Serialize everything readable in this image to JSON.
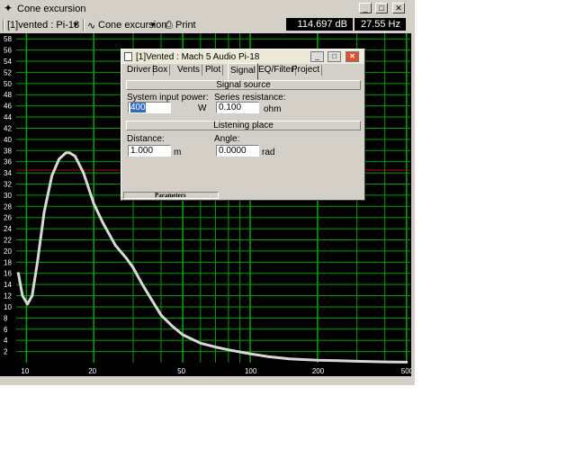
{
  "window": {
    "title": "Cone excursion",
    "title_icon": "crosshair-icon",
    "minimize": "_",
    "maximize": "□",
    "close": "✕"
  },
  "toolbar": {
    "driver_select": "[1]vented : Pi-18",
    "dropdown_arrow": "▼",
    "view_select": "Cone excursion",
    "print_label": "Print",
    "readout_db": "114.697 dB",
    "readout_hz": "27.55 Hz"
  },
  "dialog": {
    "title": "[1]Vented : Mach 5 Audio Pi-18",
    "tabs": [
      "Driver",
      "Box",
      "Vents",
      "Plot",
      "Signal",
      "EQ/Filter",
      "Project"
    ],
    "active_tab": "Signal",
    "signal_source_header": "Signal source",
    "system_input_power_label": "System input power:",
    "system_input_power_value": "400",
    "system_input_power_unit": "W",
    "series_resistance_label": "Series resistance:",
    "series_resistance_value": "0.100",
    "series_resistance_unit": "ohm",
    "listening_place_header": "Listening place",
    "distance_label": "Distance:",
    "distance_value": "1.000",
    "distance_unit": "m",
    "angle_label": "Angle:",
    "angle_value": "0.0000",
    "angle_unit": "rad",
    "status_text": "Parameters"
  },
  "colors": {
    "plot_background": "#000000",
    "grid": "#00a000",
    "reference_line": "#c00000",
    "curve": "#d8d8d8"
  },
  "chart_data": {
    "type": "line",
    "x_scale": "log",
    "xlim": [
      9,
      520
    ],
    "ylim": [
      0,
      59
    ],
    "grid": true,
    "x_tick_labels": [
      "10",
      "20",
      "50",
      "100",
      "200",
      "500"
    ],
    "x_ticks": [
      10,
      20,
      50,
      100,
      200,
      500
    ],
    "x_minor": [
      30,
      40,
      60,
      70,
      80,
      90,
      300,
      400
    ],
    "y_ticks": [
      2,
      4,
      6,
      8,
      10,
      12,
      14,
      16,
      18,
      20,
      22,
      24,
      26,
      28,
      30,
      32,
      34,
      36,
      38,
      40,
      42,
      44,
      46,
      48,
      50,
      52,
      54,
      56,
      58
    ],
    "reference_y": 34.5,
    "series": [
      {
        "x": [
          9.2,
          9.6,
          10.1,
          10.6,
          11.2,
          12,
          13,
          14,
          15,
          15.6,
          16.5,
          18,
          20,
          22,
          25,
          28,
          30,
          33,
          36,
          40,
          45,
          50,
          60,
          70,
          80,
          100,
          120,
          150,
          200,
          250,
          300,
          400,
          500
        ],
        "y": [
          16,
          12,
          10.5,
          12,
          18,
          27,
          33.5,
          36.5,
          37.6,
          37.6,
          37,
          34,
          28.5,
          25,
          21,
          18.7,
          17,
          14,
          11.5,
          8.5,
          6.5,
          5,
          3.5,
          2.8,
          2.3,
          1.6,
          1.1,
          0.7,
          0.45,
          0.35,
          0.25,
          0.15,
          0.1
        ]
      }
    ]
  }
}
